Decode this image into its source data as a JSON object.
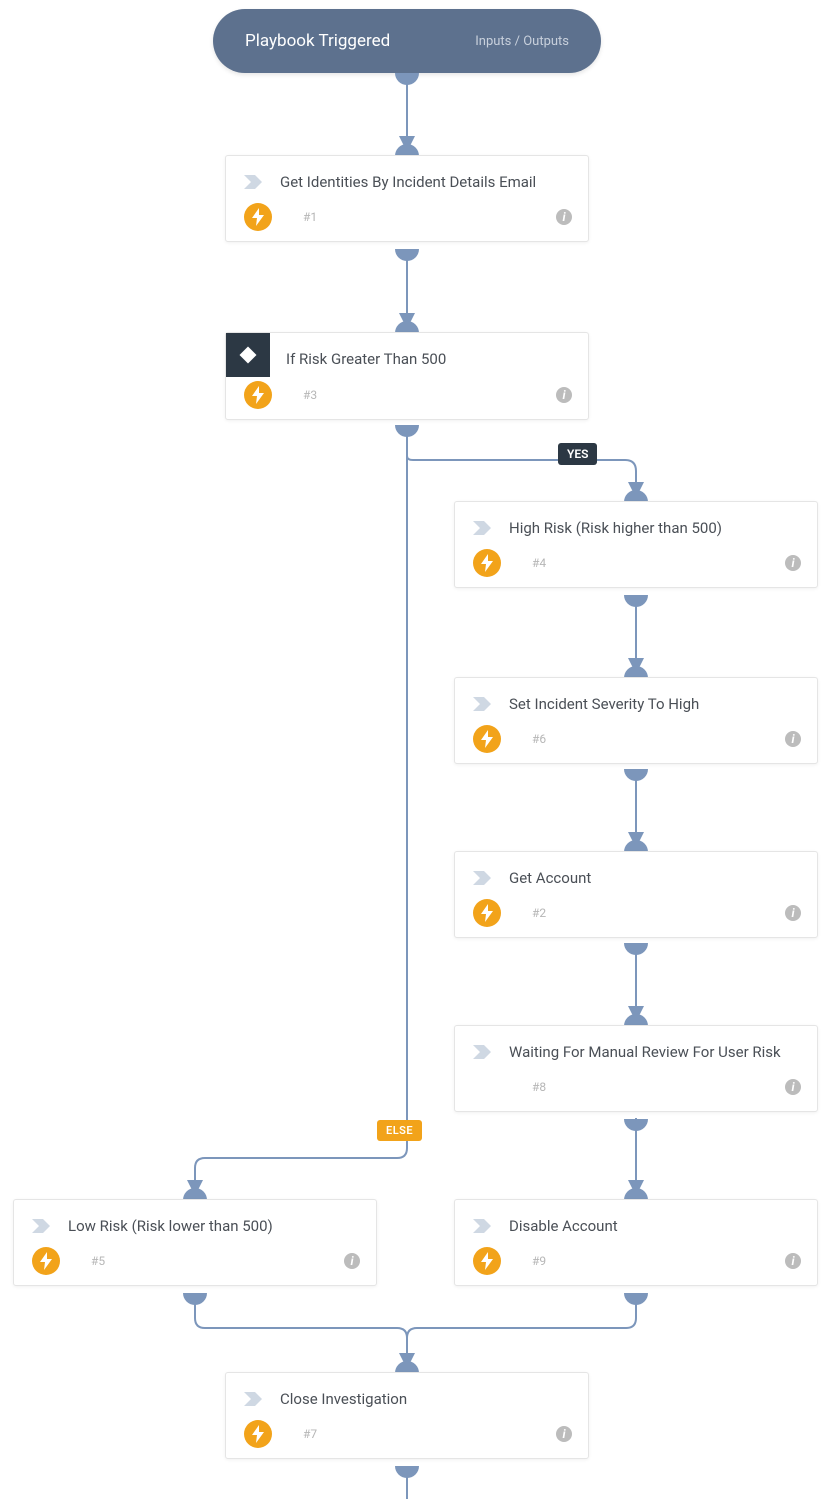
{
  "trigger": {
    "title": "Playbook Triggered",
    "io": "Inputs / Outputs"
  },
  "cards": {
    "c1": {
      "title": "Get Identities By Incident Details Email",
      "num": "#1"
    },
    "c3": {
      "title": "If Risk Greater Than 500",
      "num": "#3"
    },
    "c4": {
      "title": "High Risk (Risk higher than 500)",
      "num": "#4"
    },
    "c6": {
      "title": "Set Incident Severity To High",
      "num": "#6"
    },
    "c2": {
      "title": "Get Account",
      "num": "#2"
    },
    "c8": {
      "title": "Waiting For Manual Review For User Risk",
      "num": "#8"
    },
    "c9": {
      "title": "Disable Account",
      "num": "#9"
    },
    "c5": {
      "title": "Low Risk (Risk lower than 500)",
      "num": "#5"
    },
    "c7": {
      "title": "Close Investigation",
      "num": "#7"
    }
  },
  "labels": {
    "yes": "YES",
    "else": "ELSE"
  }
}
